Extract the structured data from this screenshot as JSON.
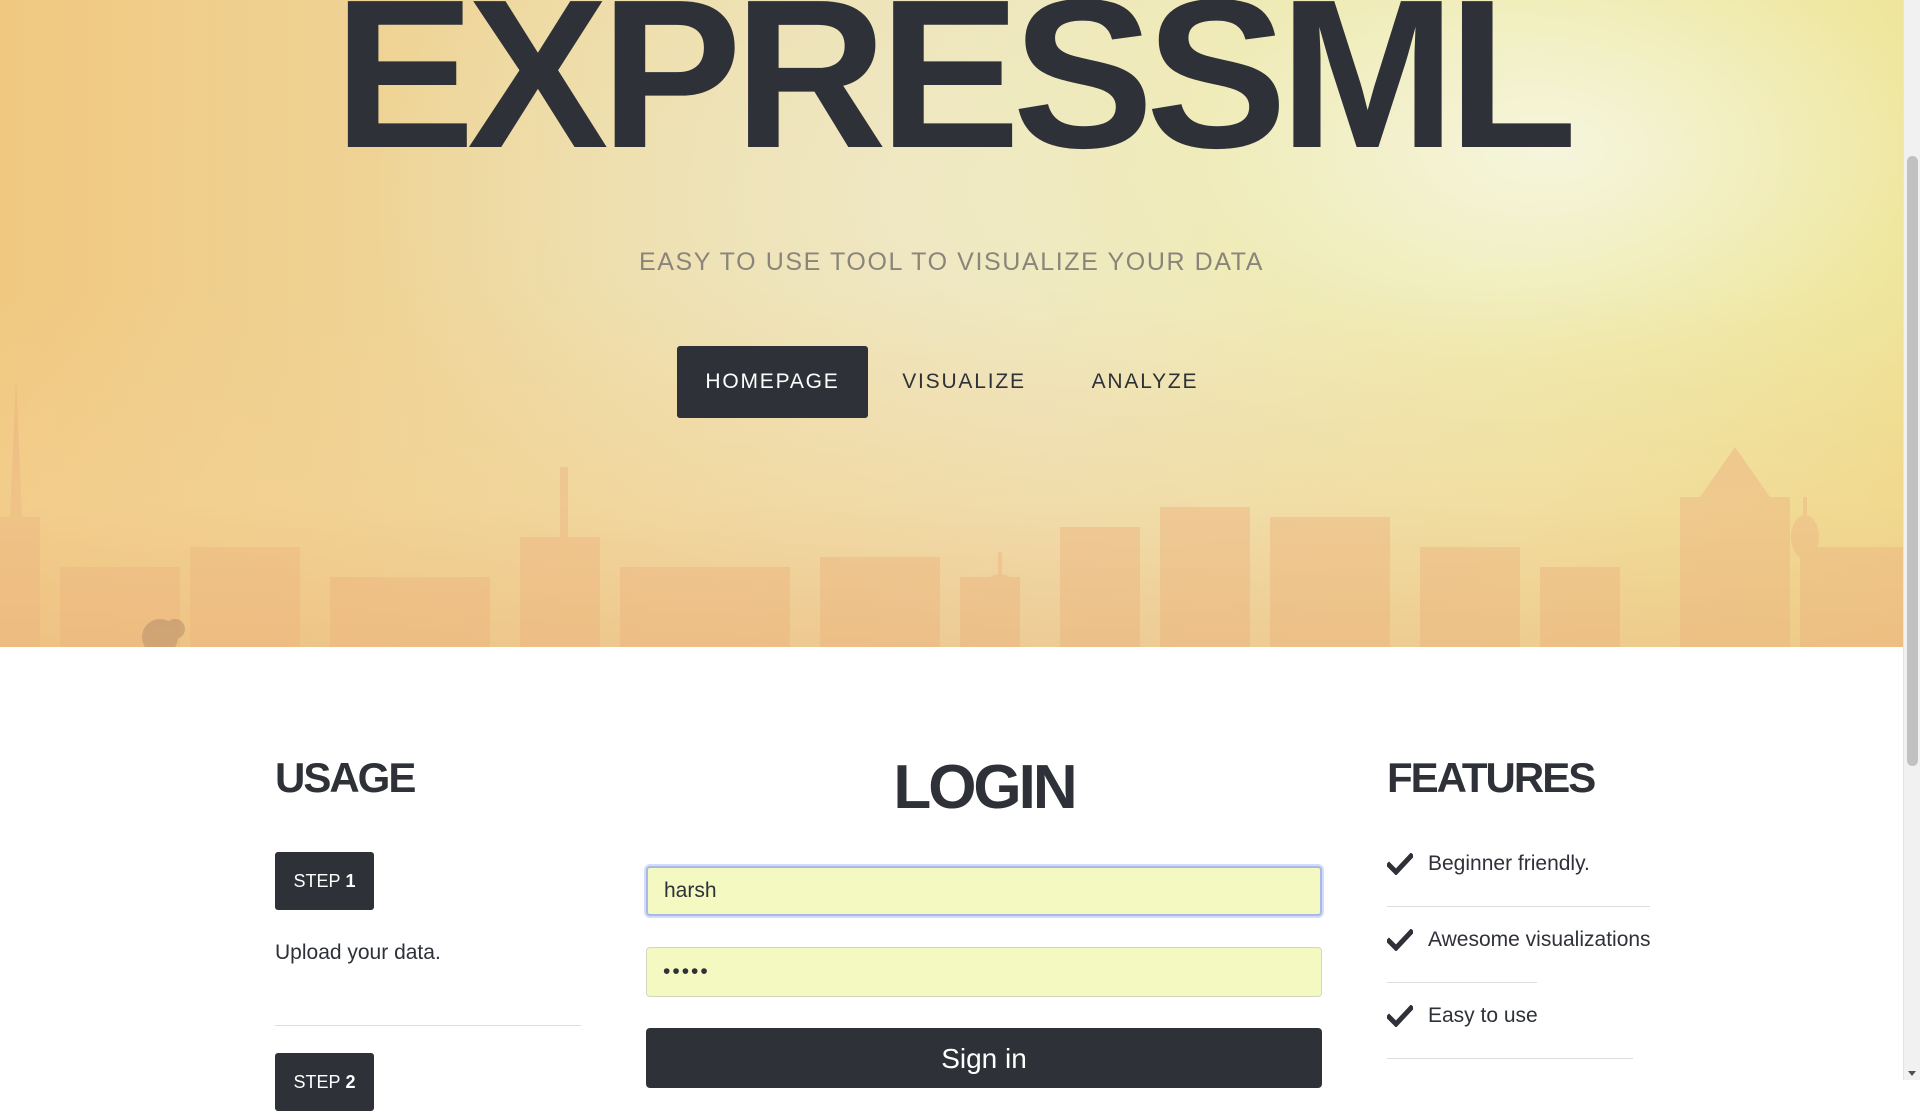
{
  "hero": {
    "title": "EXPRESSML",
    "subtitle": "EASY TO USE TOOL TO VISUALIZE YOUR DATA",
    "nav": [
      {
        "label": "HOMEPAGE",
        "active": true
      },
      {
        "label": "VISUALIZE",
        "active": false
      },
      {
        "label": "ANALYZE",
        "active": false
      }
    ]
  },
  "usage": {
    "title": "USAGE",
    "steps": [
      {
        "prefix": "STEP",
        "number": "1",
        "text": "Upload your data."
      },
      {
        "prefix": "STEP",
        "number": "2"
      }
    ]
  },
  "login": {
    "title": "LOGIN",
    "username_value": "harsh",
    "password_value": "•••••",
    "submit_label": "Sign in"
  },
  "features": {
    "title": "FEATURES",
    "items": [
      {
        "label": "Beginner friendly.",
        "icon": "check-icon"
      },
      {
        "label": "Awesome visualizations",
        "icon": "check-icon"
      },
      {
        "label": "Easy to use",
        "icon": "check-icon"
      }
    ]
  },
  "colors": {
    "primary_dark": "#2f3138",
    "input_autofill": "#f3f9c0",
    "focus_ring": "#a9b8e8"
  }
}
